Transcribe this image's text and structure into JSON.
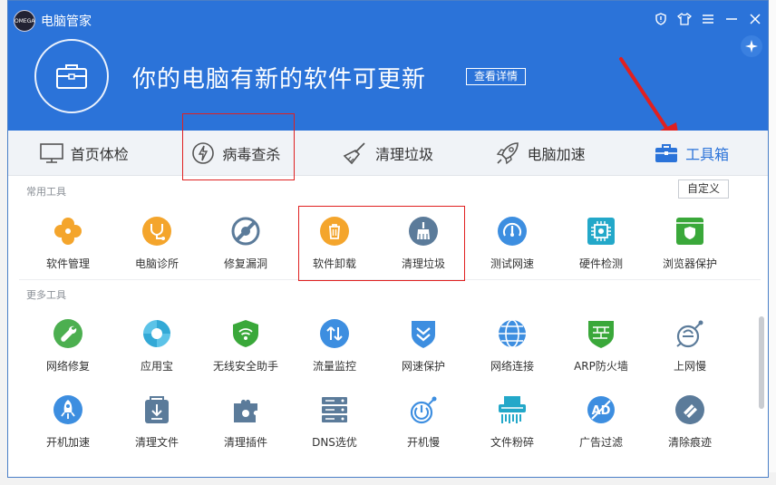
{
  "window": {
    "app_title": "电脑管家",
    "logo_text": "OMEGA",
    "hero_message": "你的电脑有新的软件可更新",
    "detail_button": "查看详情"
  },
  "window_controls": [
    "shield-icon",
    "shirt-icon",
    "menu-icon",
    "minimize-icon",
    "close-icon"
  ],
  "nav": {
    "items": [
      {
        "label": "首页体检",
        "icon": "monitor-icon",
        "active": false
      },
      {
        "label": "病毒查杀",
        "icon": "lightning-icon",
        "active": false
      },
      {
        "label": "清理垃圾",
        "icon": "broom-icon",
        "active": false
      },
      {
        "label": "电脑加速",
        "icon": "rocket-icon",
        "active": false
      },
      {
        "label": "工具箱",
        "icon": "toolbox-icon",
        "active": true
      }
    ]
  },
  "common_tools": {
    "label": "常用工具",
    "customize_label": "自定义",
    "items": [
      {
        "label": "软件管理",
        "icon": "software-manager-icon",
        "color": "#f4a52c"
      },
      {
        "label": "电脑诊所",
        "icon": "stethoscope-icon",
        "color": "#f4a52c"
      },
      {
        "label": "修复漏洞",
        "icon": "patch-icon",
        "color": "#5b7b9a"
      },
      {
        "label": "软件卸载",
        "icon": "trash-icon",
        "color": "#f4a52c"
      },
      {
        "label": "清理垃圾",
        "icon": "broom-icon",
        "color": "#5b7b9a"
      },
      {
        "label": "测试网速",
        "icon": "speedometer-icon",
        "color": "#3d8ee0"
      },
      {
        "label": "硬件检测",
        "icon": "chip-icon",
        "color": "#23a8c9"
      },
      {
        "label": "浏览器保护",
        "icon": "browser-shield-icon",
        "color": "#3aa83a"
      }
    ]
  },
  "more_tools": {
    "label": "更多工具",
    "rows": [
      [
        {
          "label": "网络修复",
          "icon": "wrench-icon",
          "color": "#4caf50"
        },
        {
          "label": "应用宝",
          "icon": "app-store-icon",
          "color": "#33a9d6"
        },
        {
          "label": "无线安全助手",
          "icon": "wifi-icon",
          "color": "#3aa83a"
        },
        {
          "label": "流量监控",
          "icon": "traffic-icon",
          "color": "#3d8ee0"
        },
        {
          "label": "网速保护",
          "icon": "chevron-shield-icon",
          "color": "#3d8ee0"
        },
        {
          "label": "网络连接",
          "icon": "globe-icon",
          "color": "#3d8ee0"
        },
        {
          "label": "ARP防火墙",
          "icon": "firewall-icon",
          "color": "#3aa83a"
        },
        {
          "label": "上网慢",
          "icon": "slow-network-icon",
          "color": "#5b7b9a"
        }
      ],
      [
        {
          "label": "开机加速",
          "icon": "boot-rocket-icon",
          "color": "#3d8ee0"
        },
        {
          "label": "清理文件",
          "icon": "clean-file-icon",
          "color": "#5b7b9a"
        },
        {
          "label": "清理插件",
          "icon": "puzzle-icon",
          "color": "#5b7b9a"
        },
        {
          "label": "DNS选优",
          "icon": "server-icon",
          "color": "#5b7b9a"
        },
        {
          "label": "开机慢",
          "icon": "slow-boot-icon",
          "color": "#3d8ee0"
        },
        {
          "label": "文件粉碎",
          "icon": "shredder-icon",
          "color": "#23a8c9"
        },
        {
          "label": "广告过滤",
          "icon": "ad-block-icon",
          "color": "#3d8ee0"
        },
        {
          "label": "清除痕迹",
          "icon": "eraser-icon",
          "color": "#5b7b9a"
        }
      ]
    ]
  },
  "colors": {
    "header_blue": "#2b73d9",
    "annotation_red": "#e02020"
  }
}
